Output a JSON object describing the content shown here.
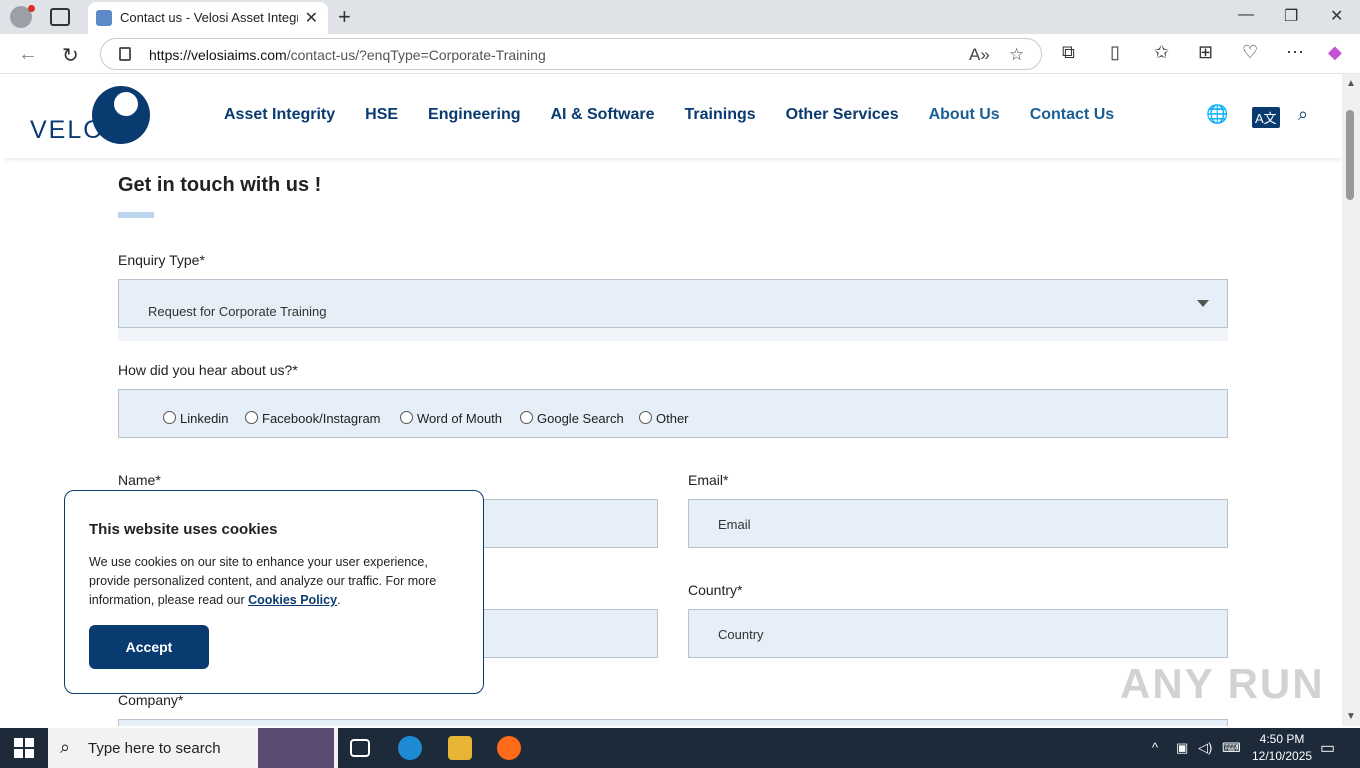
{
  "browser": {
    "tab_title": "Contact us - Velosi Asset Integrity",
    "url_host": "https://velosiaims.com",
    "url_path": "/contact-us/?enqType=Corporate-Training"
  },
  "header": {
    "logo_text": "VELOSI",
    "nav": [
      "Asset Integrity",
      "HSE",
      "Engineering",
      "AI & Software",
      "Trainings",
      "Other Services",
      "About Us",
      "Contact Us"
    ]
  },
  "form": {
    "heading": "Get in touch with us !",
    "enquiry_label": "Enquiry Type*",
    "enquiry_value": "Request for Corporate Training",
    "hear_label": "How did you hear about us?*",
    "hear_options": [
      "Linkedin",
      "Facebook/Instagram",
      "Word of Mouth",
      "Google Search",
      "Other"
    ],
    "name_label": "Name*",
    "email_label": "Email*",
    "email_placeholder": "Email",
    "country_label": "Country*",
    "country_placeholder": "Country",
    "company_label": "Company*"
  },
  "cookie": {
    "title": "This website uses cookies",
    "body": "We use cookies on our site to enhance your user experience, provide personalized content, and analyze our traffic. For more information, please read our ",
    "link": "Cookies Policy",
    "body_end": ".",
    "accept": "Accept"
  },
  "watermark": "ANY RUN",
  "taskbar": {
    "search_placeholder": "Type here to search",
    "time": "4:50 PM",
    "date": "12/10/2025"
  }
}
